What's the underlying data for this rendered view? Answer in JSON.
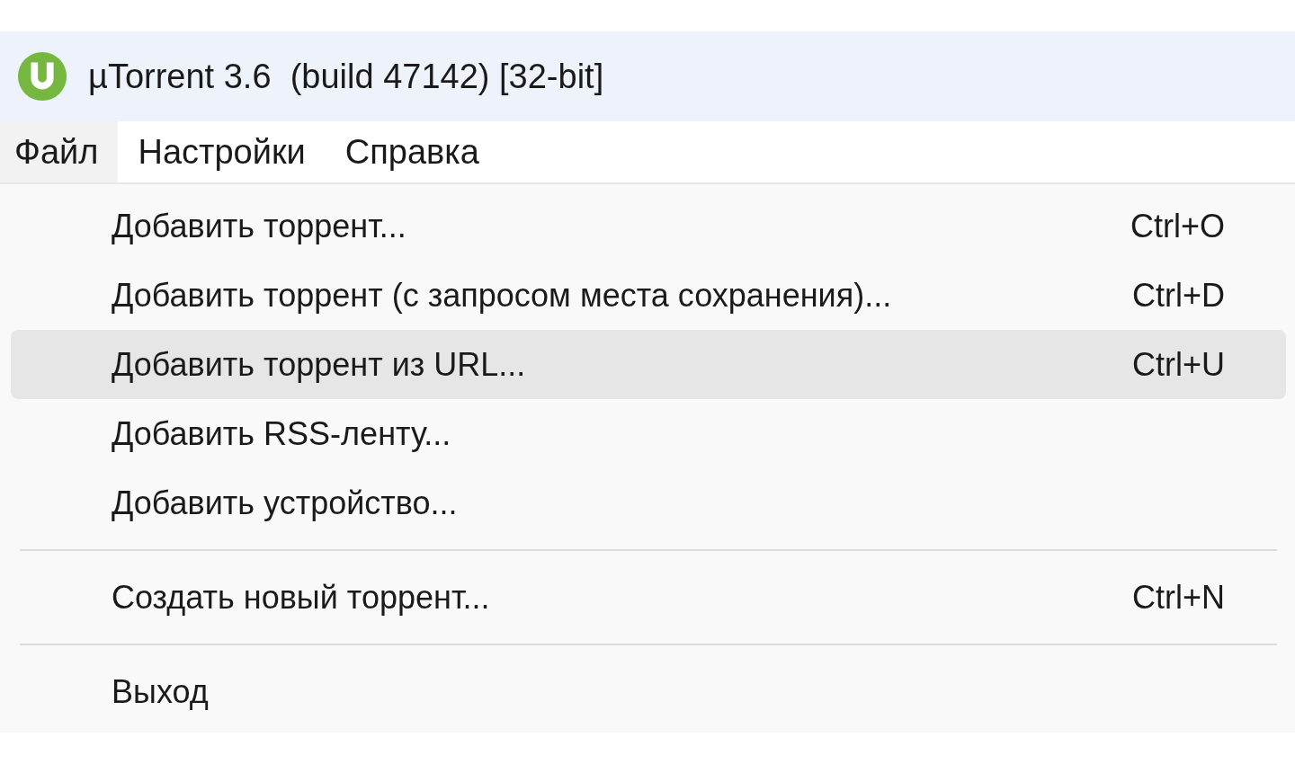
{
  "window": {
    "title": "µTorrent 3.6  (build 47142) [32-bit]"
  },
  "menu_bar": [
    {
      "label": "Файл",
      "selected": true
    },
    {
      "label": "Настройки",
      "selected": false
    },
    {
      "label": "Справка",
      "selected": false
    }
  ],
  "menu": {
    "items": [
      {
        "kind": "item",
        "label": "Добавить торрент...",
        "shortcut": "Ctrl+O",
        "highlighted": false
      },
      {
        "kind": "item",
        "label": "Добавить торрент (с запросом места сохранения)...",
        "shortcut": "Ctrl+D",
        "highlighted": false
      },
      {
        "kind": "item",
        "label": "Добавить торрент из URL...",
        "shortcut": "Ctrl+U",
        "highlighted": true
      },
      {
        "kind": "item",
        "label": "Добавить RSS-ленту...",
        "highlighted": false
      },
      {
        "kind": "item",
        "label": "Добавить устройство...",
        "highlighted": false
      },
      {
        "kind": "separator"
      },
      {
        "kind": "item",
        "label": "Создать новый торрент...",
        "shortcut": "Ctrl+N",
        "highlighted": false
      },
      {
        "kind": "separator"
      },
      {
        "kind": "item",
        "label": "Выход",
        "highlighted": false
      }
    ]
  }
}
